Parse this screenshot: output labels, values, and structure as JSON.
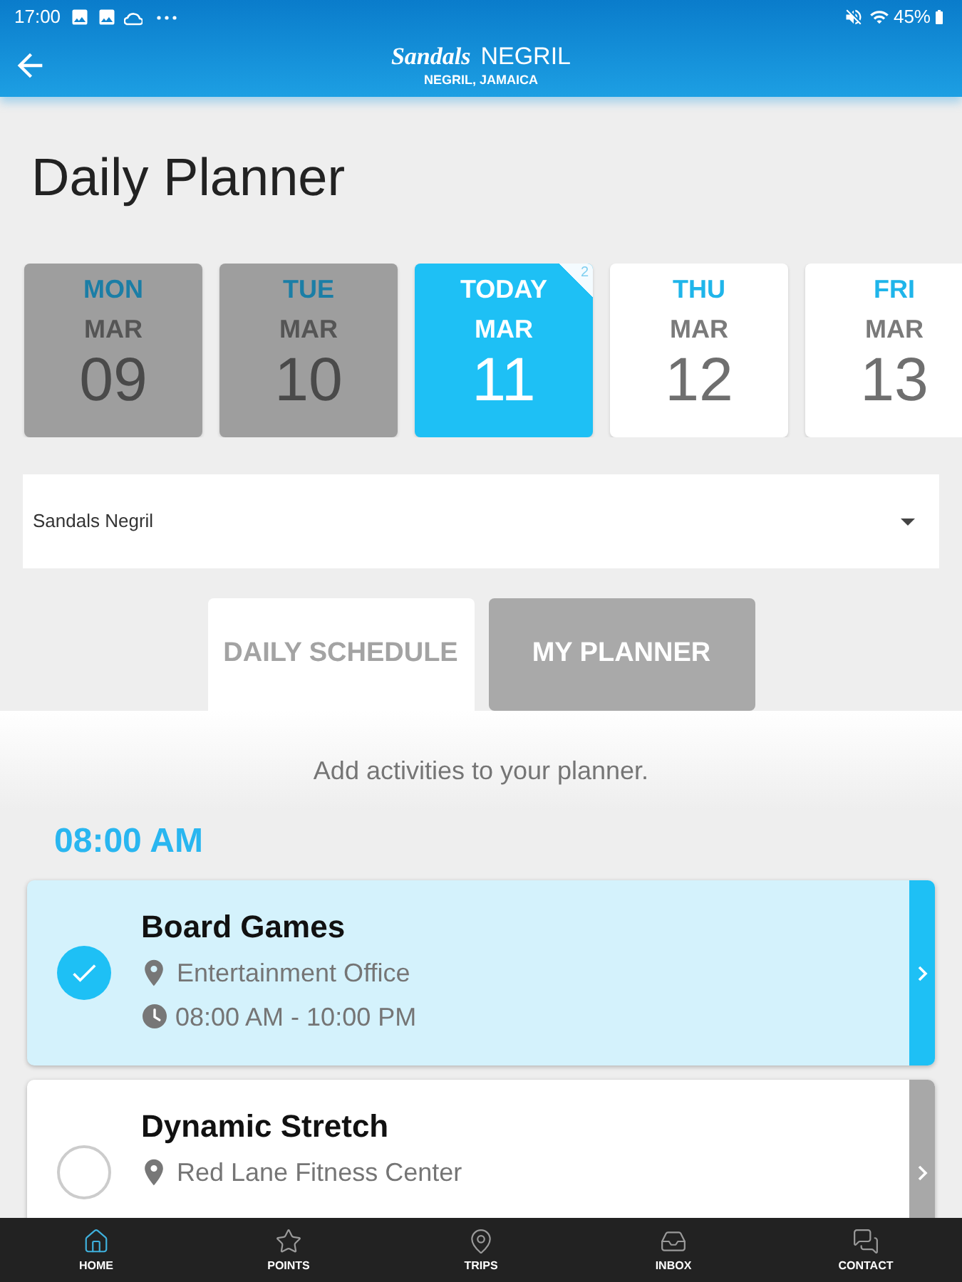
{
  "status_bar": {
    "time": "17:00",
    "battery": "45%"
  },
  "header": {
    "brand": "Sandals",
    "title": "NEGRIL",
    "subtitle": "NEGRIL, JAMAICA"
  },
  "page_title": "Daily Planner",
  "dates": [
    {
      "day": "MON",
      "month": "MAR",
      "date": "09",
      "past": true,
      "selected": false
    },
    {
      "day": "TUE",
      "month": "MAR",
      "date": "10",
      "past": true,
      "selected": false
    },
    {
      "day": "TODAY",
      "month": "MAR",
      "date": "11",
      "past": false,
      "selected": true,
      "badge": "2"
    },
    {
      "day": "THU",
      "month": "MAR",
      "date": "12",
      "past": false,
      "selected": false
    },
    {
      "day": "FRI",
      "month": "MAR",
      "date": "13",
      "past": false,
      "selected": false
    }
  ],
  "resort_select": {
    "value": "Sandals Negril"
  },
  "tabs": [
    {
      "label": "DAILY SCHEDULE",
      "selected": true
    },
    {
      "label": "MY PLANNER",
      "selected": false
    }
  ],
  "hint": "Add activities to your planner.",
  "time_groups": [
    {
      "time": "08:00 AM",
      "activities": [
        {
          "title": "Board Games",
          "location": "Entertainment Office",
          "hours": "08:00 AM - 10:00 PM",
          "checked": true
        },
        {
          "title": "Dynamic Stretch",
          "location": "Red Lane Fitness Center",
          "checked": false
        }
      ]
    }
  ],
  "nav": [
    {
      "label": "HOME",
      "selected": true
    },
    {
      "label": "POINTS",
      "selected": false
    },
    {
      "label": "TRIPS",
      "selected": false
    },
    {
      "label": "INBOX",
      "selected": false
    },
    {
      "label": "CONTACT",
      "selected": false
    }
  ]
}
